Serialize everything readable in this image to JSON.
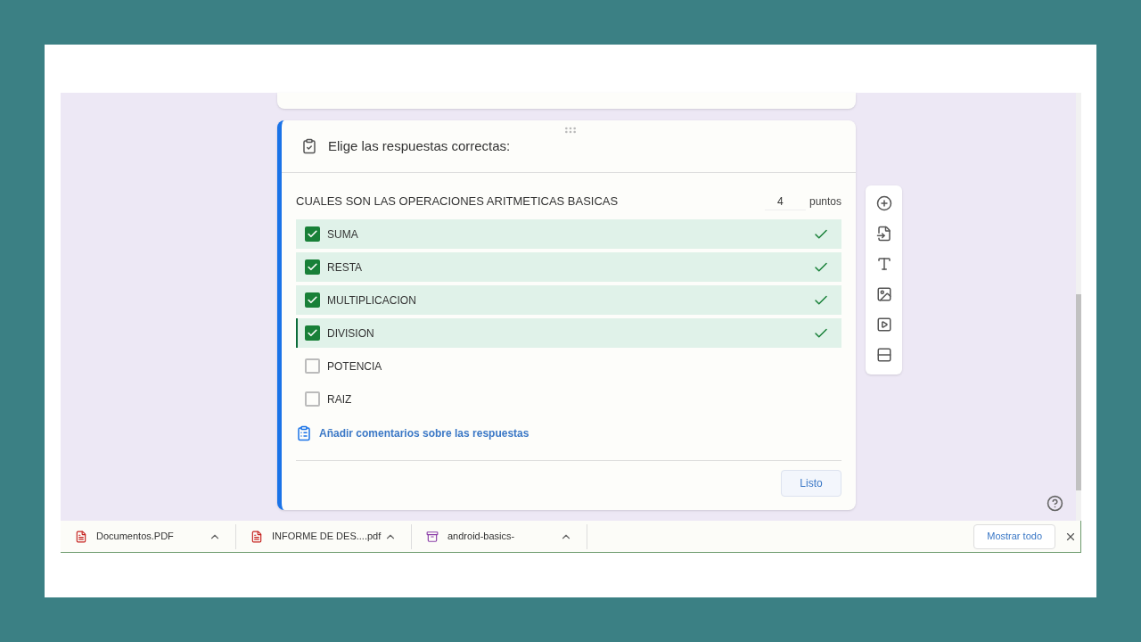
{
  "question_card": {
    "header": "Elige las respuestas correctas:",
    "question": "CUALES SON LAS OPERACIONES ARITMETICAS BASICAS",
    "points_value": "4",
    "points_label": "puntos",
    "options": [
      {
        "label": "SUMA",
        "checked": true,
        "focused": false
      },
      {
        "label": "RESTA",
        "checked": true,
        "focused": false
      },
      {
        "label": "MULTIPLICACION",
        "checked": true,
        "focused": false
      },
      {
        "label": "DIVISION",
        "checked": true,
        "focused": true
      },
      {
        "label": "POTENCIA",
        "checked": false,
        "focused": false
      },
      {
        "label": "RAIZ",
        "checked": false,
        "focused": false
      }
    ],
    "feedback_link": "Añadir comentarios sobre las respuestas",
    "done_button": "Listo"
  },
  "downloads": {
    "items": [
      {
        "name": "Documentos.PDF",
        "kind": "pdf"
      },
      {
        "name": "INFORME DE DES....pdf",
        "kind": "pdf"
      },
      {
        "name": "android-basics-",
        "kind": "archive"
      }
    ],
    "show_all": "Mostrar todo"
  }
}
